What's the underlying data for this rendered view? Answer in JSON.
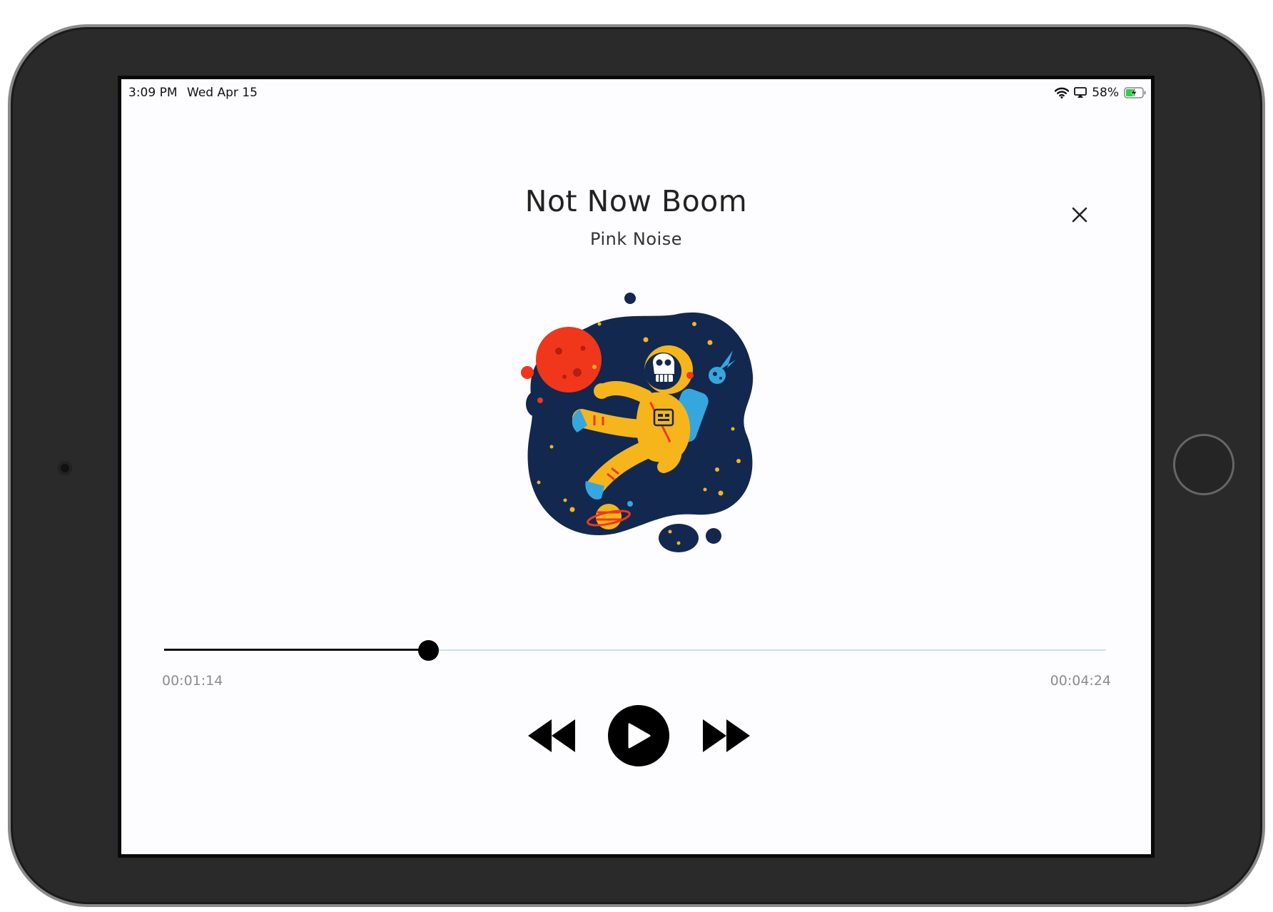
{
  "status_bar": {
    "time": "3:09 PM",
    "date": "Wed Apr 15",
    "battery_percent": "58%",
    "battery_level": 0.58,
    "icons": [
      "wifi-icon",
      "airplay-icon",
      "battery-charging-icon"
    ]
  },
  "player": {
    "title": "Not Now Boom",
    "artist": "Pink Noise",
    "artwork": "astronaut-illustration",
    "elapsed": "00:01:14",
    "total": "00:04:24",
    "progress_fraction": 0.28
  },
  "controls": {
    "close": "close-icon",
    "rewind": "rewind-icon",
    "play": "play-icon",
    "forward": "fast-forward-icon"
  },
  "colors": {
    "space_blue": "#12284e",
    "planet_red": "#f0371c",
    "suit_yellow": "#f7b51c",
    "accent_blue": "#36a7de",
    "progress_track": "#c9e2f3"
  }
}
